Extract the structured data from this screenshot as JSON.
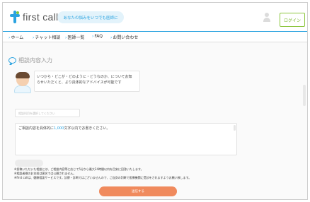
{
  "header": {
    "logo_text": "first call",
    "tagline": "あなたの悩みをいつでも医師に",
    "user_label": "",
    "login_button": "ログイン"
  },
  "nav": {
    "items": [
      {
        "label": "ホーム"
      },
      {
        "label": "チャット相談"
      },
      {
        "label": "医師一覧"
      },
      {
        "label": "FAQ"
      },
      {
        "label": "お問い合わせ"
      }
    ]
  },
  "main": {
    "section_title": "相談内容入力",
    "speech_lines": [
      "いつから・どこが・どのように・どうなのか、についてお知",
      "らせいただくと、より具体的なアドバイスが可能です"
    ],
    "select_placeholder": "相談科目を選択してください",
    "textarea_prefix": "ご相談内容を具体的に",
    "textarea_highlight": "1,000",
    "textarea_suffix": "文字以内でお書きください。",
    "mini_button": "",
    "notes": [
      "※投稿いただいた相談には、ご相談内容等に応じて5分から最大24時間以内を目安に回答いたします。",
      "※相談者様のお名前は匿名では公開されません。",
      "※first callは、健康相談サービスです。診察・診断ではございませんので、ご自身の判断で医療機関に受診をされますようお願い致します。"
    ],
    "submit_button": "送信する"
  },
  "colors": {
    "brand_blue": "#2aa3e0",
    "login_green": "#8cc63e",
    "submit_orange": "#f08a5d"
  }
}
